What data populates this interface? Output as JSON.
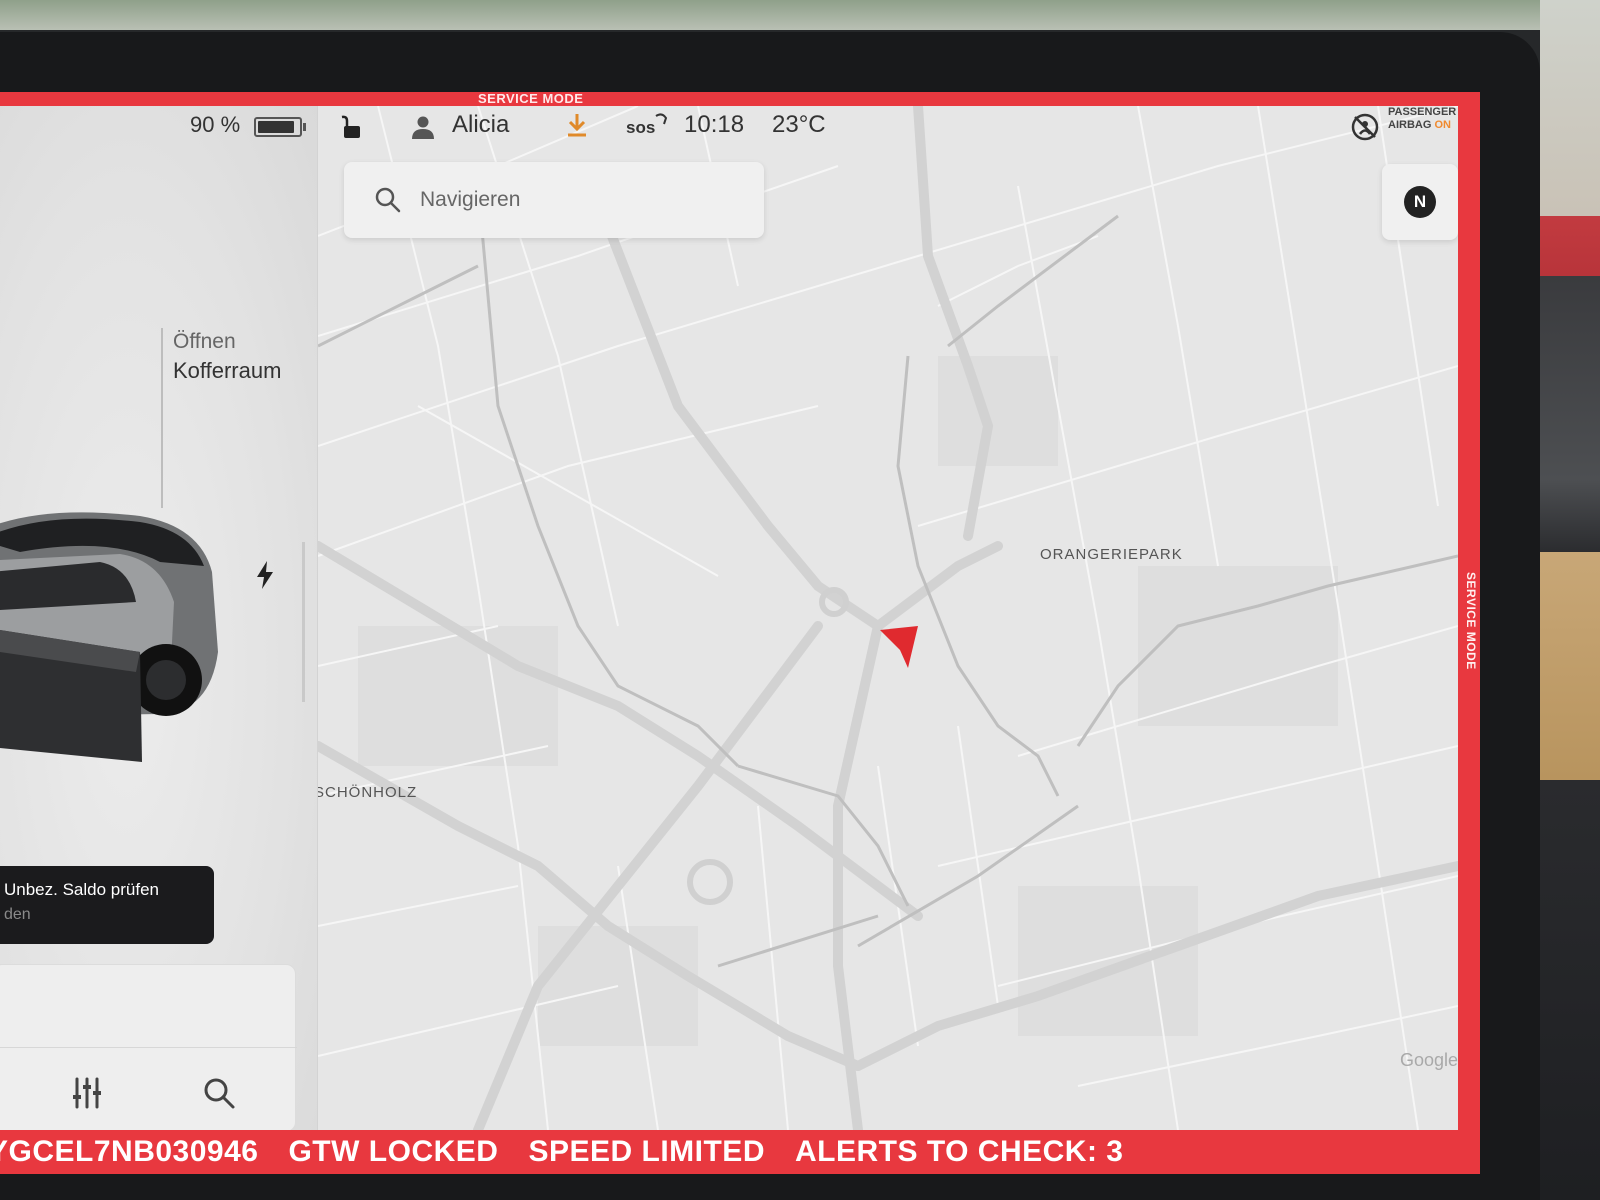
{
  "top_bar": {
    "battery_percent": "90 %",
    "battery_level": 0.9,
    "user_name": "Alicia",
    "sos_label": "sos",
    "time": "10:18",
    "temperature": "23°C",
    "airbag_label_line1": "PASSENGER",
    "airbag_label_line2": "AIRBAG",
    "airbag_state": "ON"
  },
  "service_mode": {
    "top_label": "SERVICE MODE",
    "side_label": "SERVICE MODE",
    "frame_color": "#e8383f"
  },
  "left_panel": {
    "trunk_action": "Öffnen",
    "trunk_name": "Kofferraum",
    "toast_title": "Unbez. Saldo prüfen",
    "toast_sub": "den"
  },
  "map": {
    "search_placeholder": "Navigieren",
    "compass_label": "N",
    "places": [
      "ORANGERIEPARK",
      "SCHÖNHOLZ"
    ],
    "attribution": "Google",
    "position_marker_color": "#e02a2f"
  },
  "status_strip": {
    "items": [
      "YGCEL7NB030946",
      "GTW LOCKED",
      "SPEED LIMITED",
      "ALERTS TO CHECK: 3"
    ]
  },
  "icons": [
    "lock-open-icon",
    "user-icon",
    "download-icon",
    "airbag-off-icon",
    "charge-bolt-icon",
    "sliders-icon",
    "search-icon",
    "compass-icon",
    "nav-arrow-icon"
  ]
}
